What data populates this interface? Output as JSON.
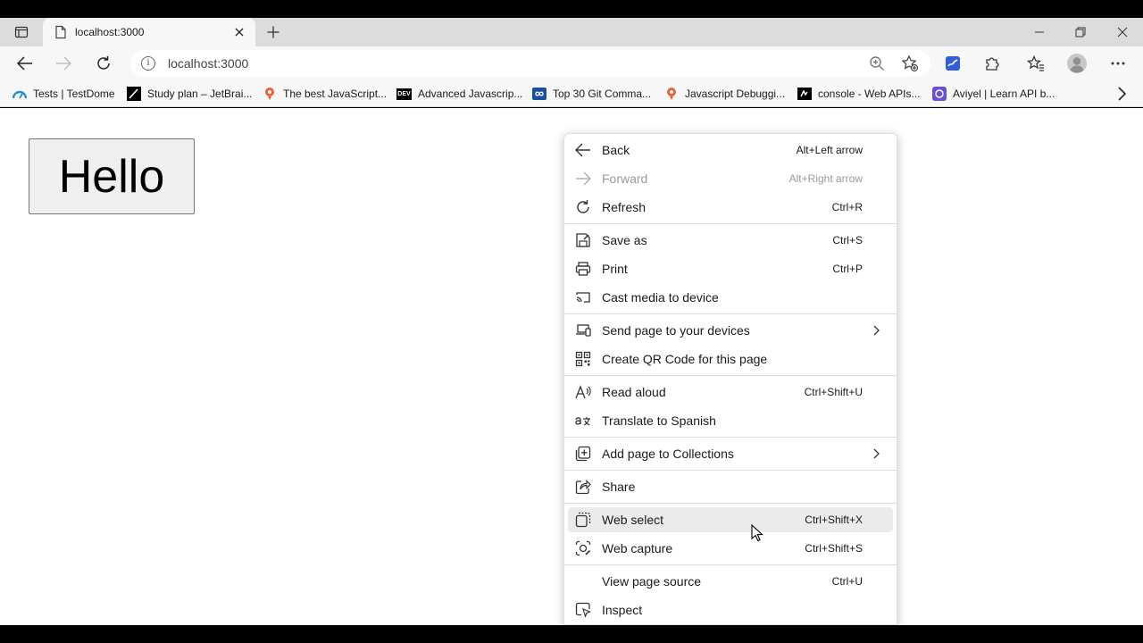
{
  "tab": {
    "title": "localhost:3000"
  },
  "address_bar": {
    "url": "localhost:3000"
  },
  "bookmarks": [
    {
      "label": "Tests | TestDome",
      "icon": "testdome-icon"
    },
    {
      "label": "Study plan – JetBrai...",
      "icon": "jetbrains-icon"
    },
    {
      "label": "The best JavaScript...",
      "icon": "javascript-icon"
    },
    {
      "label": "Advanced Javascrip...",
      "icon": "dev-icon",
      "icon_text": "DEV"
    },
    {
      "label": "Top 30 Git Comma...",
      "icon": "infinity-icon"
    },
    {
      "label": "Javascript Debuggi...",
      "icon": "javascript-icon"
    },
    {
      "label": "console - Web APIs...",
      "icon": "mdn-icon"
    },
    {
      "label": "Aviyel | Learn API b...",
      "icon": "aviyel-icon"
    }
  ],
  "page": {
    "button_label": "Hello"
  },
  "context_menu": {
    "items": [
      {
        "label": "Back",
        "shortcut": "Alt+Left arrow",
        "icon": "back-arrow-icon"
      },
      {
        "label": "Forward",
        "shortcut": "Alt+Right arrow",
        "icon": "forward-arrow-icon",
        "disabled": true
      },
      {
        "label": "Refresh",
        "shortcut": "Ctrl+R",
        "icon": "refresh-icon"
      },
      {
        "label": "Save as",
        "shortcut": "Ctrl+S",
        "icon": "save-icon"
      },
      {
        "label": "Print",
        "shortcut": "Ctrl+P",
        "icon": "print-icon"
      },
      {
        "label": "Cast media to device",
        "shortcut": "",
        "icon": "cast-icon"
      },
      {
        "label": "Send page to your devices",
        "shortcut": "",
        "icon": "devices-icon",
        "submenu": true
      },
      {
        "label": "Create QR Code for this page",
        "shortcut": "",
        "icon": "qr-code-icon"
      },
      {
        "label": "Read aloud",
        "shortcut": "Ctrl+Shift+U",
        "icon": "read-aloud-icon"
      },
      {
        "label": "Translate to Spanish",
        "shortcut": "",
        "icon": "translate-icon"
      },
      {
        "label": "Add page to Collections",
        "shortcut": "",
        "icon": "collections-icon",
        "submenu": true
      },
      {
        "label": "Share",
        "shortcut": "",
        "icon": "share-icon"
      },
      {
        "label": "Web select",
        "shortcut": "Ctrl+Shift+X",
        "icon": "web-select-icon",
        "hovered": true
      },
      {
        "label": "Web capture",
        "shortcut": "Ctrl+Shift+S",
        "icon": "web-capture-icon"
      },
      {
        "label": "View page source",
        "shortcut": "Ctrl+U",
        "icon": ""
      },
      {
        "label": "Inspect",
        "shortcut": "",
        "icon": "inspect-icon"
      }
    ]
  }
}
